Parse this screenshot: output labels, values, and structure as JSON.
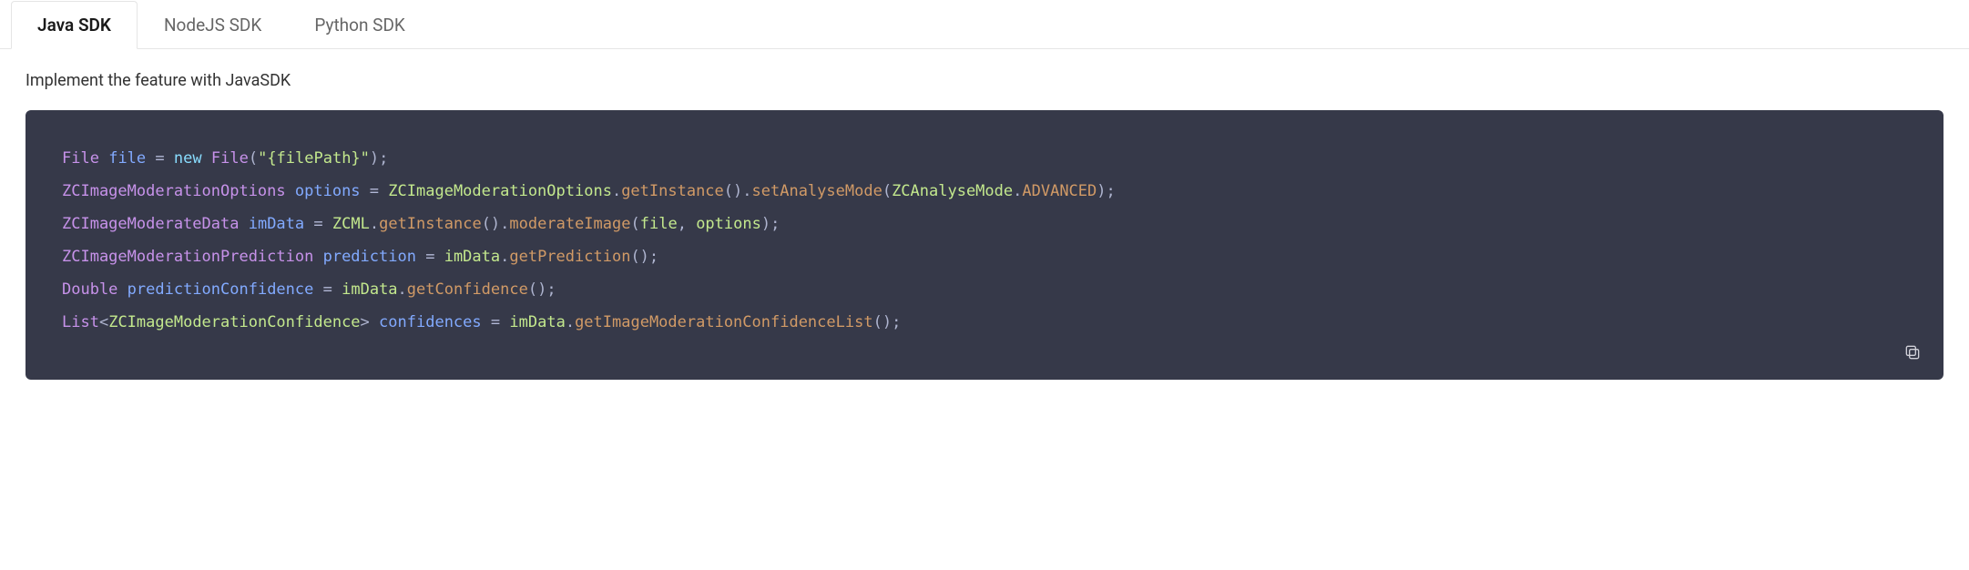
{
  "tabs": {
    "items": [
      {
        "label": "Java SDK",
        "active": true
      },
      {
        "label": "NodeJS SDK",
        "active": false
      },
      {
        "label": "Python SDK",
        "active": false
      }
    ]
  },
  "content": {
    "description": "Implement the feature with JavaSDK"
  },
  "code": {
    "lines": [
      {
        "tokens": [
          {
            "t": "File",
            "c": "c-type"
          },
          {
            "t": " ",
            "c": "c-plain"
          },
          {
            "t": "file",
            "c": "c-var"
          },
          {
            "t": " ",
            "c": "c-plain"
          },
          {
            "t": "=",
            "c": "c-op"
          },
          {
            "t": " ",
            "c": "c-plain"
          },
          {
            "t": "new",
            "c": "c-kw"
          },
          {
            "t": " ",
            "c": "c-plain"
          },
          {
            "t": "File",
            "c": "c-type"
          },
          {
            "t": "(",
            "c": "c-paren"
          },
          {
            "t": "\"{filePath}\"",
            "c": "c-str"
          },
          {
            "t": ")",
            "c": "c-paren"
          },
          {
            "t": ";",
            "c": "c-semi"
          }
        ]
      },
      {
        "tokens": [
          {
            "t": "ZCImageModerationOptions",
            "c": "c-type"
          },
          {
            "t": " ",
            "c": "c-plain"
          },
          {
            "t": "options",
            "c": "c-var"
          },
          {
            "t": " ",
            "c": "c-plain"
          },
          {
            "t": "=",
            "c": "c-op"
          },
          {
            "t": " ",
            "c": "c-plain"
          },
          {
            "t": "ZCImageModerationOptions",
            "c": "c-str"
          },
          {
            "t": ".",
            "c": "c-dot"
          },
          {
            "t": "getInstance",
            "c": "c-method"
          },
          {
            "t": "()",
            "c": "c-paren"
          },
          {
            "t": ".",
            "c": "c-dot"
          },
          {
            "t": "setAnalyseMode",
            "c": "c-method"
          },
          {
            "t": "(",
            "c": "c-paren"
          },
          {
            "t": "ZCAnalyseMode",
            "c": "c-str"
          },
          {
            "t": ".",
            "c": "c-dot"
          },
          {
            "t": "ADVANCED",
            "c": "c-const"
          },
          {
            "t": ")",
            "c": "c-paren"
          },
          {
            "t": ";",
            "c": "c-semi"
          }
        ]
      },
      {
        "tokens": [
          {
            "t": "ZCImageModerateData",
            "c": "c-type"
          },
          {
            "t": " ",
            "c": "c-plain"
          },
          {
            "t": "imData",
            "c": "c-var"
          },
          {
            "t": " ",
            "c": "c-plain"
          },
          {
            "t": "=",
            "c": "c-op"
          },
          {
            "t": " ",
            "c": "c-plain"
          },
          {
            "t": "ZCML",
            "c": "c-str"
          },
          {
            "t": ".",
            "c": "c-dot"
          },
          {
            "t": "getInstance",
            "c": "c-method"
          },
          {
            "t": "()",
            "c": "c-paren"
          },
          {
            "t": ".",
            "c": "c-dot"
          },
          {
            "t": "moderateImage",
            "c": "c-method"
          },
          {
            "t": "(",
            "c": "c-paren"
          },
          {
            "t": "file",
            "c": "c-str"
          },
          {
            "t": ",",
            "c": "c-op"
          },
          {
            "t": " ",
            "c": "c-plain"
          },
          {
            "t": "options",
            "c": "c-str"
          },
          {
            "t": ")",
            "c": "c-paren"
          },
          {
            "t": ";",
            "c": "c-semi"
          }
        ]
      },
      {
        "tokens": [
          {
            "t": "ZCImageModerationPrediction",
            "c": "c-type"
          },
          {
            "t": " ",
            "c": "c-plain"
          },
          {
            "t": "prediction",
            "c": "c-var"
          },
          {
            "t": " ",
            "c": "c-plain"
          },
          {
            "t": "=",
            "c": "c-op"
          },
          {
            "t": " ",
            "c": "c-plain"
          },
          {
            "t": "imData",
            "c": "c-str"
          },
          {
            "t": ".",
            "c": "c-dot"
          },
          {
            "t": "getPrediction",
            "c": "c-method"
          },
          {
            "t": "()",
            "c": "c-paren"
          },
          {
            "t": ";",
            "c": "c-semi"
          }
        ]
      },
      {
        "tokens": [
          {
            "t": "Double",
            "c": "c-type"
          },
          {
            "t": " ",
            "c": "c-plain"
          },
          {
            "t": "predictionConfidence",
            "c": "c-var"
          },
          {
            "t": " ",
            "c": "c-plain"
          },
          {
            "t": "=",
            "c": "c-op"
          },
          {
            "t": " ",
            "c": "c-plain"
          },
          {
            "t": "imData",
            "c": "c-str"
          },
          {
            "t": ".",
            "c": "c-dot"
          },
          {
            "t": "getConfidence",
            "c": "c-method"
          },
          {
            "t": "()",
            "c": "c-paren"
          },
          {
            "t": ";",
            "c": "c-semi"
          }
        ]
      },
      {
        "tokens": [
          {
            "t": "List",
            "c": "c-type"
          },
          {
            "t": "<",
            "c": "c-generic"
          },
          {
            "t": "ZCImageModerationConfidence",
            "c": "c-str"
          },
          {
            "t": ">",
            "c": "c-generic"
          },
          {
            "t": " ",
            "c": "c-plain"
          },
          {
            "t": "confidences",
            "c": "c-var"
          },
          {
            "t": " ",
            "c": "c-plain"
          },
          {
            "t": "=",
            "c": "c-op"
          },
          {
            "t": " ",
            "c": "c-plain"
          },
          {
            "t": "imData",
            "c": "c-str"
          },
          {
            "t": ".",
            "c": "c-dot"
          },
          {
            "t": "getImageModerationConfidenceList",
            "c": "c-method"
          },
          {
            "t": "()",
            "c": "c-paren"
          },
          {
            "t": ";",
            "c": "c-semi"
          }
        ]
      }
    ]
  },
  "actions": {
    "copy_label": "Copy"
  }
}
